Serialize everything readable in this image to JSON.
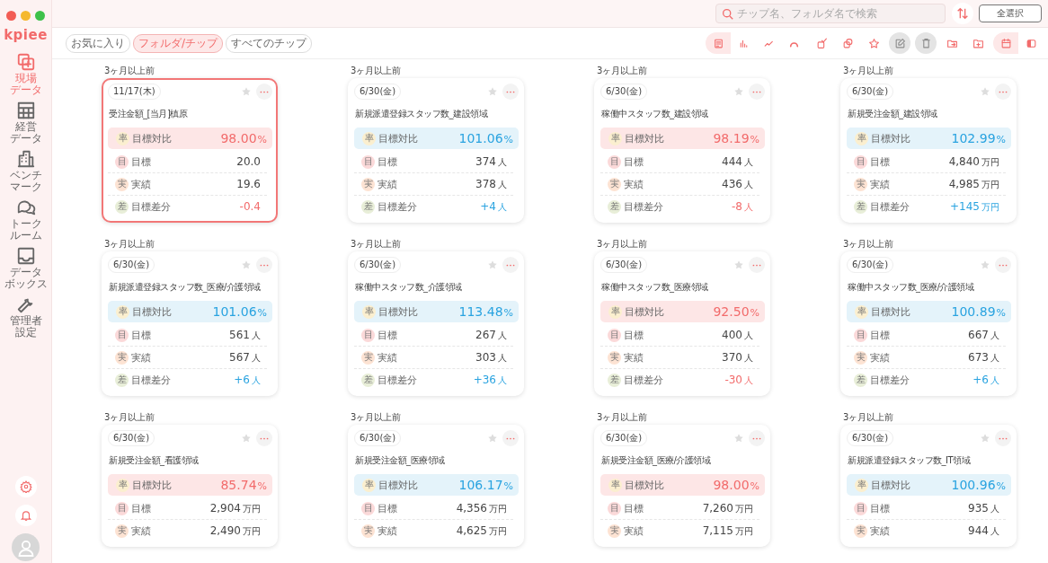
{
  "app": {
    "logo": "kpiee"
  },
  "sidebar": {
    "items": [
      {
        "kind": "field",
        "lines": [
          "現場",
          "データ"
        ],
        "selected": true
      },
      {
        "kind": "grid",
        "lines": [
          "経営",
          "データ"
        ],
        "selected": false
      },
      {
        "kind": "building",
        "lines": [
          "ベンチ",
          "マーク"
        ],
        "selected": false
      },
      {
        "kind": "chat",
        "lines": [
          "トーク",
          "ルーム"
        ],
        "selected": false
      },
      {
        "kind": "inbox",
        "lines": [
          "データ",
          "ボックス"
        ],
        "selected": false
      },
      {
        "kind": "wrench",
        "lines": [
          "管理者",
          "設定"
        ],
        "selected": false
      }
    ]
  },
  "header": {
    "search": {
      "placeholder": "チップ名、フォルダ名で検索"
    },
    "select_all": "全選択"
  },
  "filters": [
    {
      "label": "お気に入り",
      "selected": false
    },
    {
      "label": "フォルダ/チップ",
      "selected": true
    },
    {
      "label": "すべてのチップ",
      "selected": false
    }
  ],
  "toolbar": {
    "view_modes": [
      {
        "kind": "list",
        "selected": true
      },
      {
        "kind": "bar",
        "selected": false
      },
      {
        "kind": "line",
        "selected": false
      },
      {
        "kind": "gauge",
        "selected": false
      }
    ],
    "actions": [
      {
        "kind": "check",
        "disabled": false
      },
      {
        "kind": "copy",
        "disabled": false
      },
      {
        "kind": "star",
        "disabled": false
      },
      {
        "kind": "edit",
        "disabled": true
      },
      {
        "kind": "trash",
        "disabled": true
      },
      {
        "kind": "move",
        "disabled": false
      },
      {
        "kind": "newfolder",
        "disabled": false
      }
    ],
    "layout_modes": [
      {
        "kind": "cards",
        "selected": true
      },
      {
        "kind": "panel",
        "selected": false
      }
    ]
  },
  "cards": [
    {
      "period": "3ヶ月以上前",
      "date": "11/17(木)",
      "selected": true,
      "title": "受注金額_[当月]槙原",
      "rows": [
        {
          "kind": "rate",
          "badge": "率",
          "label": "目標対比",
          "value": "98.00",
          "unit": "%",
          "below_target": true
        },
        {
          "kind": "target",
          "badge": "目",
          "label": "目標",
          "value": "20.0"
        },
        {
          "kind": "actual",
          "badge": "実",
          "label": "実績",
          "value": "19.6"
        },
        {
          "kind": "diff",
          "badge": "差",
          "label": "目標差分",
          "value": "-0.4",
          "below_target": true
        }
      ]
    },
    {
      "period": "3ヶ月以上前",
      "date": "6/30(金)",
      "selected": false,
      "title": "新規派遣登録スタッフ数_建設領域",
      "rows": [
        {
          "kind": "rate",
          "badge": "率",
          "label": "目標対比",
          "value": "101.06",
          "unit": "%",
          "below_target": false
        },
        {
          "kind": "target",
          "badge": "目",
          "label": "目標",
          "value": "374",
          "unit": "人"
        },
        {
          "kind": "actual",
          "badge": "実",
          "label": "実績",
          "value": "378",
          "unit": "人"
        },
        {
          "kind": "diff",
          "badge": "差",
          "label": "目標差分",
          "value": "+4",
          "unit": "人",
          "below_target": false
        }
      ]
    },
    {
      "period": "3ヶ月以上前",
      "date": "6/30(金)",
      "selected": false,
      "title": "稼働中スタッフ数_建設領域",
      "rows": [
        {
          "kind": "rate",
          "badge": "率",
          "label": "目標対比",
          "value": "98.19",
          "unit": "%",
          "below_target": true
        },
        {
          "kind": "target",
          "badge": "目",
          "label": "目標",
          "value": "444",
          "unit": "人"
        },
        {
          "kind": "actual",
          "badge": "実",
          "label": "実績",
          "value": "436",
          "unit": "人"
        },
        {
          "kind": "diff",
          "badge": "差",
          "label": "目標差分",
          "value": "-8",
          "unit": "人",
          "below_target": true
        }
      ]
    },
    {
      "period": "3ヶ月以上前",
      "date": "6/30(金)",
      "selected": false,
      "title": "新規受注金額_建設領域",
      "rows": [
        {
          "kind": "rate",
          "badge": "率",
          "label": "目標対比",
          "value": "102.99",
          "unit": "%",
          "below_target": false
        },
        {
          "kind": "target",
          "badge": "目",
          "label": "目標",
          "value": "4,840",
          "unit": "万円"
        },
        {
          "kind": "actual",
          "badge": "実",
          "label": "実績",
          "value": "4,985",
          "unit": "万円"
        },
        {
          "kind": "diff",
          "badge": "差",
          "label": "目標差分",
          "value": "+145",
          "unit": "万円",
          "below_target": false
        }
      ]
    },
    {
      "period": "3ヶ月以上前",
      "date": "6/30(金)",
      "selected": false,
      "title": "新規派遣登録スタッフ数_医療/介護領域",
      "rows": [
        {
          "kind": "rate",
          "badge": "率",
          "label": "目標対比",
          "value": "101.06",
          "unit": "%",
          "below_target": false
        },
        {
          "kind": "target",
          "badge": "目",
          "label": "目標",
          "value": "561",
          "unit": "人"
        },
        {
          "kind": "actual",
          "badge": "実",
          "label": "実績",
          "value": "567",
          "unit": "人"
        },
        {
          "kind": "diff",
          "badge": "差",
          "label": "目標差分",
          "value": "+6",
          "unit": "人",
          "below_target": false
        }
      ]
    },
    {
      "period": "3ヶ月以上前",
      "date": "6/30(金)",
      "selected": false,
      "title": "稼働中スタッフ数_介護領域",
      "rows": [
        {
          "kind": "rate",
          "badge": "率",
          "label": "目標対比",
          "value": "113.48",
          "unit": "%",
          "below_target": false
        },
        {
          "kind": "target",
          "badge": "目",
          "label": "目標",
          "value": "267",
          "unit": "人"
        },
        {
          "kind": "actual",
          "badge": "実",
          "label": "実績",
          "value": "303",
          "unit": "人"
        },
        {
          "kind": "diff",
          "badge": "差",
          "label": "目標差分",
          "value": "+36",
          "unit": "人",
          "below_target": false
        }
      ]
    },
    {
      "period": "3ヶ月以上前",
      "date": "6/30(金)",
      "selected": false,
      "title": "稼働中スタッフ数_医療領域",
      "rows": [
        {
          "kind": "rate",
          "badge": "率",
          "label": "目標対比",
          "value": "92.50",
          "unit": "%",
          "below_target": true
        },
        {
          "kind": "target",
          "badge": "目",
          "label": "目標",
          "value": "400",
          "unit": "人"
        },
        {
          "kind": "actual",
          "badge": "実",
          "label": "実績",
          "value": "370",
          "unit": "人"
        },
        {
          "kind": "diff",
          "badge": "差",
          "label": "目標差分",
          "value": "-30",
          "unit": "人",
          "below_target": true
        }
      ]
    },
    {
      "period": "3ヶ月以上前",
      "date": "6/30(金)",
      "selected": false,
      "title": "稼働中スタッフ数_医療/介護領域",
      "rows": [
        {
          "kind": "rate",
          "badge": "率",
          "label": "目標対比",
          "value": "100.89",
          "unit": "%",
          "below_target": false
        },
        {
          "kind": "target",
          "badge": "目",
          "label": "目標",
          "value": "667",
          "unit": "人"
        },
        {
          "kind": "actual",
          "badge": "実",
          "label": "実績",
          "value": "673",
          "unit": "人"
        },
        {
          "kind": "diff",
          "badge": "差",
          "label": "目標差分",
          "value": "+6",
          "unit": "人",
          "below_target": false
        }
      ]
    },
    {
      "period": "3ヶ月以上前",
      "date": "6/30(金)",
      "selected": false,
      "title": "新規受注金額_看護領域",
      "rows": [
        {
          "kind": "rate",
          "badge": "率",
          "label": "目標対比",
          "value": "85.74",
          "unit": "%",
          "below_target": true
        },
        {
          "kind": "target",
          "badge": "目",
          "label": "目標",
          "value": "2,904",
          "unit": "万円"
        },
        {
          "kind": "actual",
          "badge": "実",
          "label": "実績",
          "value": "2,490",
          "unit": "万円"
        }
      ]
    },
    {
      "period": "3ヶ月以上前",
      "date": "6/30(金)",
      "selected": false,
      "title": "新規受注金額_医療領域",
      "rows": [
        {
          "kind": "rate",
          "badge": "率",
          "label": "目標対比",
          "value": "106.17",
          "unit": "%",
          "below_target": false
        },
        {
          "kind": "target",
          "badge": "目",
          "label": "目標",
          "value": "4,356",
          "unit": "万円"
        },
        {
          "kind": "actual",
          "badge": "実",
          "label": "実績",
          "value": "4,625",
          "unit": "万円"
        }
      ]
    },
    {
      "period": "3ヶ月以上前",
      "date": "6/30(金)",
      "selected": false,
      "title": "新規受注金額_医療/介護領域",
      "rows": [
        {
          "kind": "rate",
          "badge": "率",
          "label": "目標対比",
          "value": "98.00",
          "unit": "%",
          "below_target": true
        },
        {
          "kind": "target",
          "badge": "目",
          "label": "目標",
          "value": "7,260",
          "unit": "万円"
        },
        {
          "kind": "actual",
          "badge": "実",
          "label": "実績",
          "value": "7,115",
          "unit": "万円"
        }
      ]
    },
    {
      "period": "3ヶ月以上前",
      "date": "6/30(金)",
      "selected": false,
      "title": "新規派遣登録スタッフ数_IT領域",
      "rows": [
        {
          "kind": "rate",
          "badge": "率",
          "label": "目標対比",
          "value": "100.96",
          "unit": "%",
          "below_target": false
        },
        {
          "kind": "target",
          "badge": "目",
          "label": "目標",
          "value": "935",
          "unit": "人"
        },
        {
          "kind": "actual",
          "badge": "実",
          "label": "実績",
          "value": "944",
          "unit": "人"
        }
      ]
    }
  ]
}
